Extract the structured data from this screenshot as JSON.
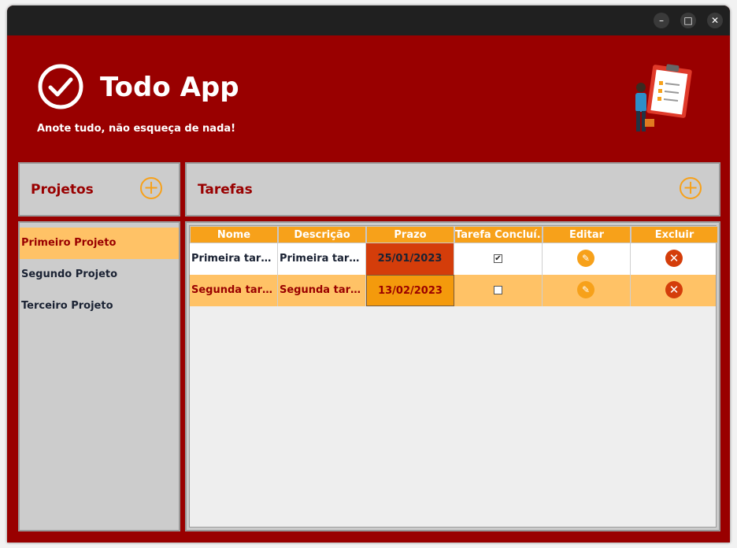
{
  "window": {
    "controls": {
      "minimize": "–",
      "maximize": "□",
      "close": "✕"
    }
  },
  "header": {
    "title": "Todo App",
    "subtitle": "Anote tudo, não esqueça de nada!",
    "logo_icon": "check-circle-icon",
    "illustration": "person-clipboard-checklist-icon"
  },
  "projects_panel": {
    "title": "Projetos",
    "add_symbol": "+"
  },
  "tasks_panel": {
    "title": "Tarefas",
    "add_symbol": "+"
  },
  "projects": [
    {
      "label": "Primeiro Projeto",
      "selected": true
    },
    {
      "label": "Segundo Projeto",
      "selected": false
    },
    {
      "label": "Terceiro Projeto",
      "selected": false
    }
  ],
  "table": {
    "columns": [
      "Nome",
      "Descrição",
      "Prazo",
      "Tarefa Concluí...",
      "Editar",
      "Excluir"
    ],
    "rows": [
      {
        "nome": "Primeira tarefa",
        "descricao": "Primeira taref...",
        "prazo": "25/01/2023",
        "concluida": true,
        "check_mark": "✔"
      },
      {
        "nome": "Segunda tarefa",
        "descricao": "Segunda taref...",
        "prazo": "13/02/2023",
        "concluida": false,
        "check_mark": ""
      }
    ],
    "edit_icon": "✎",
    "delete_icon": "✕"
  },
  "colors": {
    "brand_red": "#990000",
    "accent_orange": "#f7a11a",
    "selection": "#ffc266",
    "panel_gray": "#cccccc",
    "delete_red": "#d43d0a"
  }
}
